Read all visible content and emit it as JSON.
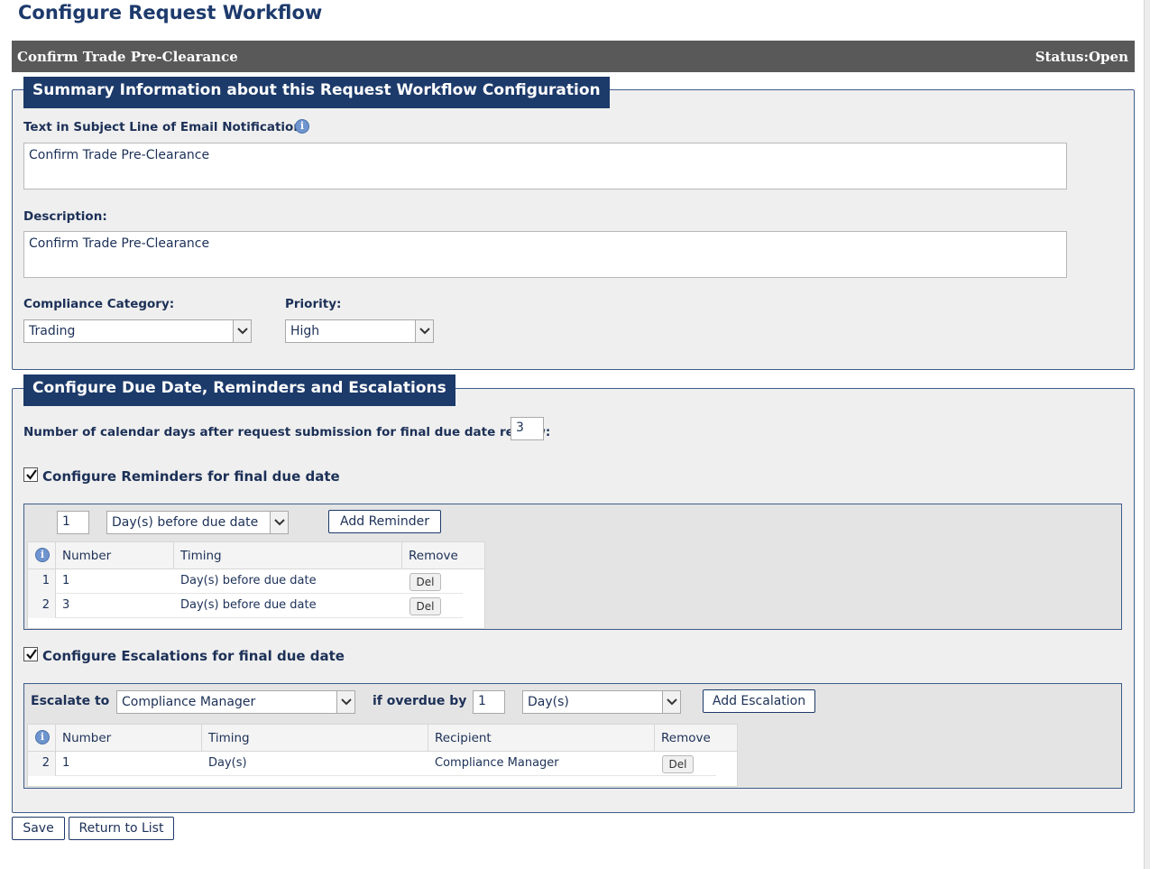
{
  "page": {
    "title": "Configure Request Workflow"
  },
  "header_bar": {
    "name": "Confirm Trade Pre-Clearance",
    "status": "Status:Open"
  },
  "summary": {
    "heading": "Summary Information about this Request Workflow Configuration",
    "subject_label": "Text in Subject Line of Email Notification:",
    "subject_value": "Confirm Trade Pre-Clearance",
    "description_label": "Description:",
    "description_value": "Confirm Trade Pre-Clearance",
    "category_label": "Compliance Category:",
    "category_value": "Trading",
    "priority_label": "Priority:",
    "priority_value": "High"
  },
  "due": {
    "heading": "Configure Due Date, Reminders and Escalations",
    "days_label": "Number of calendar days after request submission for final due date review:",
    "days_value": "3",
    "reminders": {
      "checkbox_label": "Configure Reminders for final due date",
      "checked": true,
      "amount_value": "1",
      "timing_value": "Day(s) before due date",
      "add_button": "Add Reminder",
      "columns": {
        "number": "Number",
        "timing": "Timing",
        "remove": "Remove"
      },
      "rows": [
        {
          "row": "1",
          "number": "1",
          "timing": "Day(s) before due date",
          "remove": "Del"
        },
        {
          "row": "2",
          "number": "3",
          "timing": "Day(s) before due date",
          "remove": "Del"
        }
      ]
    },
    "escalations": {
      "checkbox_label": "Configure Escalations for final due date",
      "checked": true,
      "escalate_to_label": "Escalate to",
      "escalate_to_value": "Compliance Manager",
      "overdue_label": "if overdue by",
      "overdue_value": "1",
      "unit_value": "Day(s)",
      "add_button": "Add Escalation",
      "columns": {
        "number": "Number",
        "timing": "Timing",
        "recipient": "Recipient",
        "remove": "Remove"
      },
      "rows": [
        {
          "row": "2",
          "number": "1",
          "timing": "Day(s)",
          "recipient": "Compliance Manager",
          "remove": "Del"
        }
      ]
    }
  },
  "footer": {
    "save": "Save",
    "return": "Return to List"
  },
  "icons": {
    "info": "info-icon",
    "dropdown": "chevron-down-icon",
    "check": "checkmark-icon"
  },
  "colors": {
    "heading_bg": "#1c3a6a",
    "bar_bg": "#595959",
    "panel_bg": "#efefef",
    "text": "#1c3057"
  }
}
